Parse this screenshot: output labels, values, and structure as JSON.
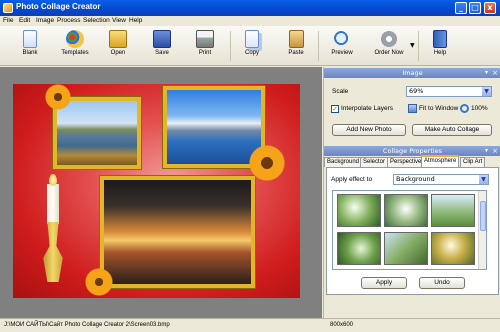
{
  "window": {
    "title": "Photo Collage Creator",
    "minimize": "_",
    "maximize": "□",
    "close": "x"
  },
  "menu": [
    "File",
    "Edit",
    "Image",
    "Process",
    "Selection",
    "View",
    "Help"
  ],
  "toolbar": {
    "blank": "Blank",
    "templates": "Templates",
    "open": "Open",
    "save": "Save",
    "print": "Print",
    "copy": "Copy",
    "paste": "Paste",
    "preview": "Preview",
    "order_now": "Order Now",
    "help": "Help"
  },
  "image_panel": {
    "title": "Image",
    "scale_label": "Scale",
    "scale_value": "69%",
    "interpolate_label": "Interpolate Layers",
    "interpolate_checked": true,
    "fit_to_window": "Fit to Window",
    "zoom_100": "100%",
    "add_photo": "Add New Photo",
    "auto_collage": "Make Auto Collage"
  },
  "collage_properties": {
    "title": "Collage Properties",
    "tabs": [
      "Background",
      "Selector",
      "Perspective",
      "Atmosphere",
      "Clip Art"
    ],
    "active_tab": "Atmosphere",
    "apply_effect_label": "Apply effect to",
    "apply_effect_value": "Background",
    "apply_button": "Apply",
    "undo_button": "Undo"
  },
  "status": {
    "path": "J:\\МОИ САЙТЫ\\Сайт Photo Collage Creator 2\\Screen03.bmp",
    "size": "800x600"
  },
  "colors": {
    "titlebar": "#0a5ee8",
    "collage_bg": "#d01c1c",
    "frame_gold": "#e2b628",
    "tab_active": "#f3b03a"
  }
}
